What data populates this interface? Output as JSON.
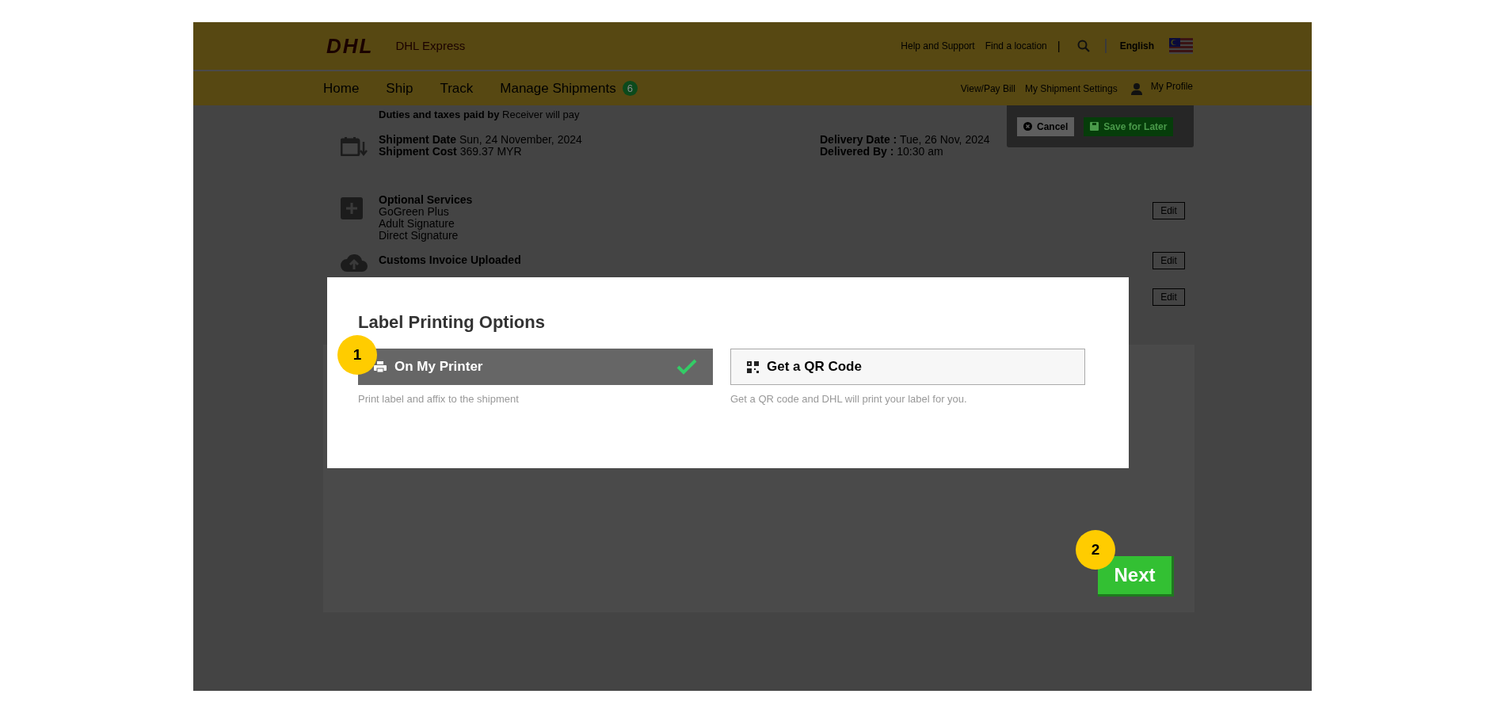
{
  "header": {
    "logo": "DHL",
    "brand": "DHL Express",
    "top_links": [
      "Help and Support",
      "Find a location"
    ],
    "separator": "|",
    "language": "English"
  },
  "nav": {
    "items": [
      {
        "label": "Home"
      },
      {
        "label": "Ship"
      },
      {
        "label": "Track"
      },
      {
        "label": "Manage Shipments",
        "badge": "6"
      }
    ],
    "right_links": [
      {
        "label": "View/Pay Bill",
        "kind": "link"
      },
      {
        "label": "My Shipment Settings",
        "kind": "link"
      },
      {
        "label": "My Profile",
        "kind": "profile"
      }
    ]
  },
  "toolbar": {
    "buttons": [
      {
        "label": "Cancel",
        "kind": "cancel"
      },
      {
        "label": "Save for Later",
        "kind": "save"
      }
    ]
  },
  "summary": {
    "duties": {
      "label": "Duties and taxes paid by",
      "value": "Receiver will pay"
    },
    "rows": [
      {
        "kind": "dates",
        "lines": [
          {
            "label": "Shipment Date",
            "value": "Sun, 24 November, 2024"
          },
          {
            "label": "Shipment Cost",
            "value": "369.37 MYR"
          }
        ],
        "right_lines": [
          {
            "label": "Delivery Date :",
            "value": "Tue, 26 Nov, 2024"
          },
          {
            "label": "Delivered By :",
            "value": "10:30 am"
          }
        ]
      },
      {
        "kind": "services",
        "title": "Optional Services",
        "items": [
          "GoGreen Plus",
          "Adult Signature",
          "Direct Signature"
        ],
        "edit": "Edit"
      },
      {
        "kind": "customs",
        "title": "Customs Invoice Uploaded",
        "edit": "Edit"
      },
      {
        "kind": "blank",
        "edit": "Edit"
      }
    ]
  },
  "modal": {
    "title": "Label Printing Options",
    "options": [
      {
        "kind": "printer",
        "label": "On My Printer",
        "description": "Print label and affix to the shipment",
        "selected": true
      },
      {
        "kind": "qr",
        "label": "Get a QR Code",
        "description": "Get a QR code and DHL will print your label for you.",
        "selected": false
      }
    ]
  },
  "next_button": "Next",
  "step_markers": [
    "1",
    "2"
  ]
}
